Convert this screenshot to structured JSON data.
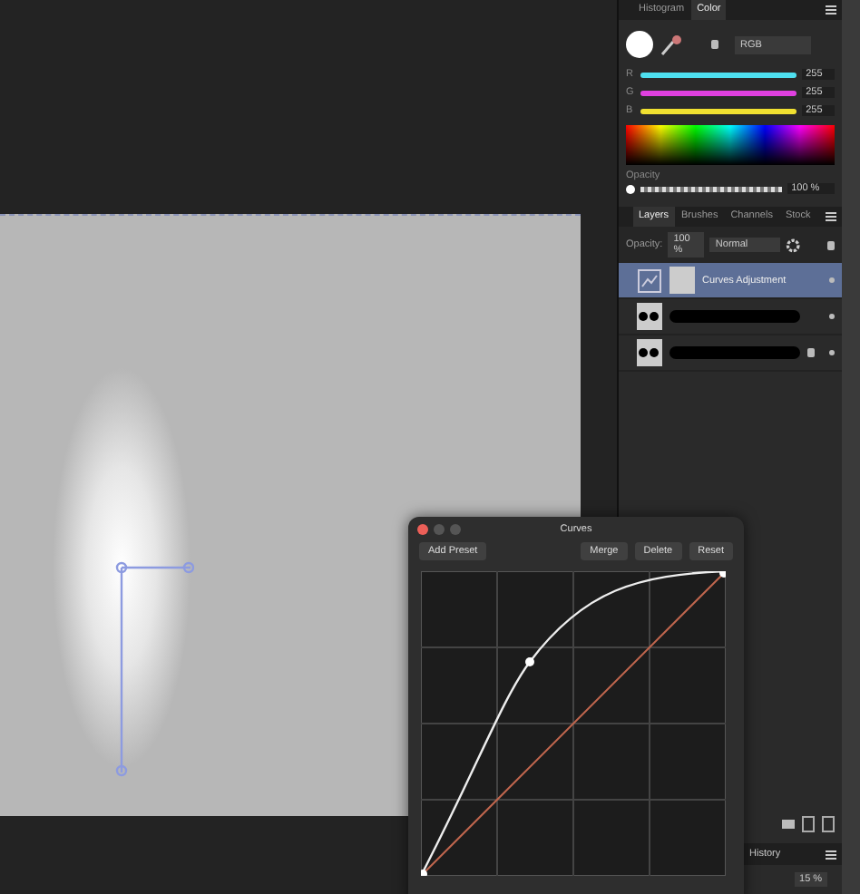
{
  "color_panel": {
    "tabs": [
      {
        "label": "Histogram",
        "selected": false
      },
      {
        "label": "Color",
        "selected": true
      }
    ],
    "mode": "RGB",
    "sliders": [
      {
        "name": "R",
        "level": 1,
        "reading": "255",
        "color": "#4ee0f0"
      },
      {
        "name": "G",
        "level": 1,
        "reading": "255",
        "color": "#e040e0"
      },
      {
        "name": "B",
        "level": 1,
        "reading": "255",
        "color": "#f0e030"
      }
    ],
    "opacity": {
      "label": "Opacity",
      "level": 1,
      "reading": "100 %"
    }
  },
  "layers_panel": {
    "tabs": [
      {
        "label": "Layers",
        "selected": true
      },
      {
        "label": "Brushes",
        "selected": false
      },
      {
        "label": "Channels",
        "selected": false
      },
      {
        "label": "Stock",
        "selected": false
      }
    ],
    "opacity_label": "Opacity:",
    "opacity_value": "100 %",
    "blend_mode": "Normal",
    "layers": [
      {
        "kind": "adjustment",
        "name": "Curves Adjustment",
        "selected": true,
        "locked": false
      },
      {
        "kind": "redacted",
        "selected": false,
        "locked": false
      },
      {
        "kind": "redacted",
        "selected": false,
        "locked": true
      }
    ]
  },
  "history_panel": {
    "label": "History",
    "zoom": "15 %"
  },
  "curves_dialog": {
    "title": "Curves",
    "buttons": [
      {
        "label": "Add Preset",
        "kind": "left"
      },
      {
        "label": "Merge",
        "kind": "right"
      },
      {
        "label": "Delete",
        "kind": "right"
      },
      {
        "label": "Reset",
        "kind": "right"
      }
    ]
  }
}
